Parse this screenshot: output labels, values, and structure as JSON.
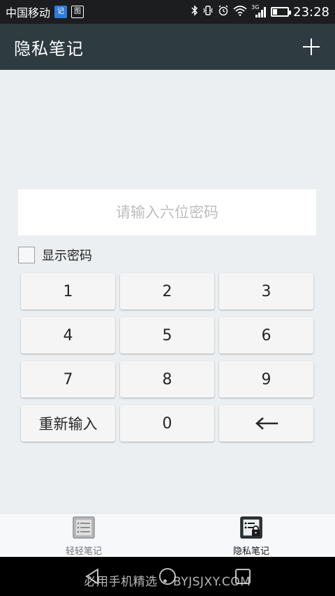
{
  "status_bar": {
    "carrier": "中国移动",
    "notif_icon_1": "记",
    "notif_icon_2": "图",
    "network": "3G",
    "time": "23:28",
    "battery_level": 0.3
  },
  "app_bar": {
    "title": "隐私笔记",
    "add_icon": "plus-icon"
  },
  "password": {
    "placeholder": "请输入六位密码",
    "value": ""
  },
  "show_password": {
    "label": "显示密码",
    "checked": false
  },
  "keypad": {
    "keys": [
      "1",
      "2",
      "3",
      "4",
      "5",
      "6",
      "7",
      "8",
      "9",
      "重新输入",
      "0"
    ],
    "backspace_icon": "arrow-left-icon"
  },
  "tabs": [
    {
      "label": "轻轻笔记",
      "icon": "notes-list-icon",
      "active": false
    },
    {
      "label": "隐私笔记",
      "icon": "private-notes-icon",
      "active": true
    }
  ],
  "watermark": "必用手机精选 • BYJSJXY.COM",
  "colors": {
    "app_bar": "#2e3b40",
    "status_bar": "#1b1d1e",
    "background": "#eceff1",
    "key": "#f5f5f5"
  }
}
